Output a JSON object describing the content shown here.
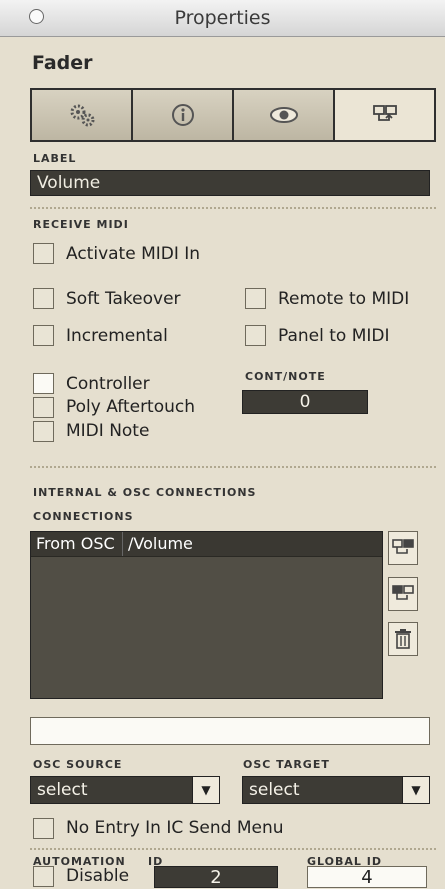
{
  "window": {
    "title": "Properties"
  },
  "object": {
    "name": "Fader"
  },
  "tabs": [
    {
      "icon": "gears-icon"
    },
    {
      "icon": "info-icon"
    },
    {
      "icon": "eye-icon"
    },
    {
      "icon": "connections-icon",
      "active": true
    }
  ],
  "label_section": {
    "heading": "LABEL",
    "value": "Volume"
  },
  "receive_midi": {
    "heading": "RECEIVE MIDI",
    "activate": "Activate MIDI In",
    "soft_takeover": "Soft Takeover",
    "remote_to_midi": "Remote to MIDI",
    "incremental": "Incremental",
    "panel_to_midi": "Panel to MIDI",
    "controller": "Controller",
    "poly_aftertouch": "Poly Aftertouch",
    "midi_note": "MIDI Note",
    "cont_note_label": "CONT/NOTE",
    "cont_note_value": "0"
  },
  "connections": {
    "heading": "INTERNAL & OSC CONNECTIONS",
    "subheading": "CONNECTIONS",
    "rows": [
      {
        "source": "From OSC",
        "target": "/Volume"
      }
    ],
    "osc_source_label": "OSC SOURCE",
    "osc_source_value": "select",
    "osc_target_label": "OSC TARGET",
    "osc_target_value": "select",
    "no_entry": "No Entry In IC Send Menu"
  },
  "automation": {
    "heading": "AUTOMATION",
    "disable": "Disable",
    "id_label": "ID",
    "id_value": "2",
    "global_id_label": "GLOBAL ID",
    "global_id_value": "4"
  }
}
